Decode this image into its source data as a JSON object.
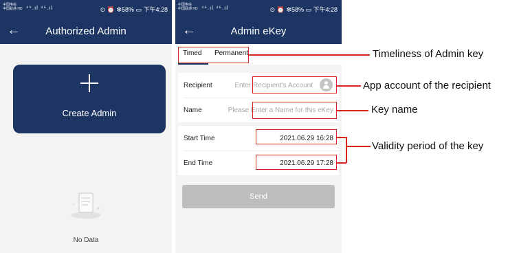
{
  "status_bar": {
    "carrier_line1": "中国电信",
    "carrier_line2": "中国联通 HD",
    "signal": "⁴⁶.ıl ⁴⁶.ıl",
    "right": "⊙ ⏰ ✻58% ▭ 下午4:28"
  },
  "screen1": {
    "title": "Authorized Admin",
    "create_label": "Create Admin",
    "no_data": "No Data"
  },
  "screen2": {
    "title": "Admin eKey",
    "tabs": [
      "Timed",
      "Permanent"
    ],
    "recipient_label": "Recipient",
    "recipient_placeholder": "Enter Recipient's Account",
    "name_label": "Name",
    "name_placeholder": "Please Enter a Name for this eKey",
    "start_label": "Start Time",
    "start_value": "2021.06.29 16:28",
    "end_label": "End Time",
    "end_value": "2021.06.29 17:28",
    "send_label": "Send"
  },
  "annotations": {
    "timeliness": "Timeliness of Admin key",
    "app_account": "App account of the recipient",
    "key_name": "Key name",
    "validity": "Validity period of the key"
  },
  "colors": {
    "brand_navy": "#1c3563",
    "annotation_red": "#d9261c",
    "disabled_button": "#bdbdbd"
  }
}
